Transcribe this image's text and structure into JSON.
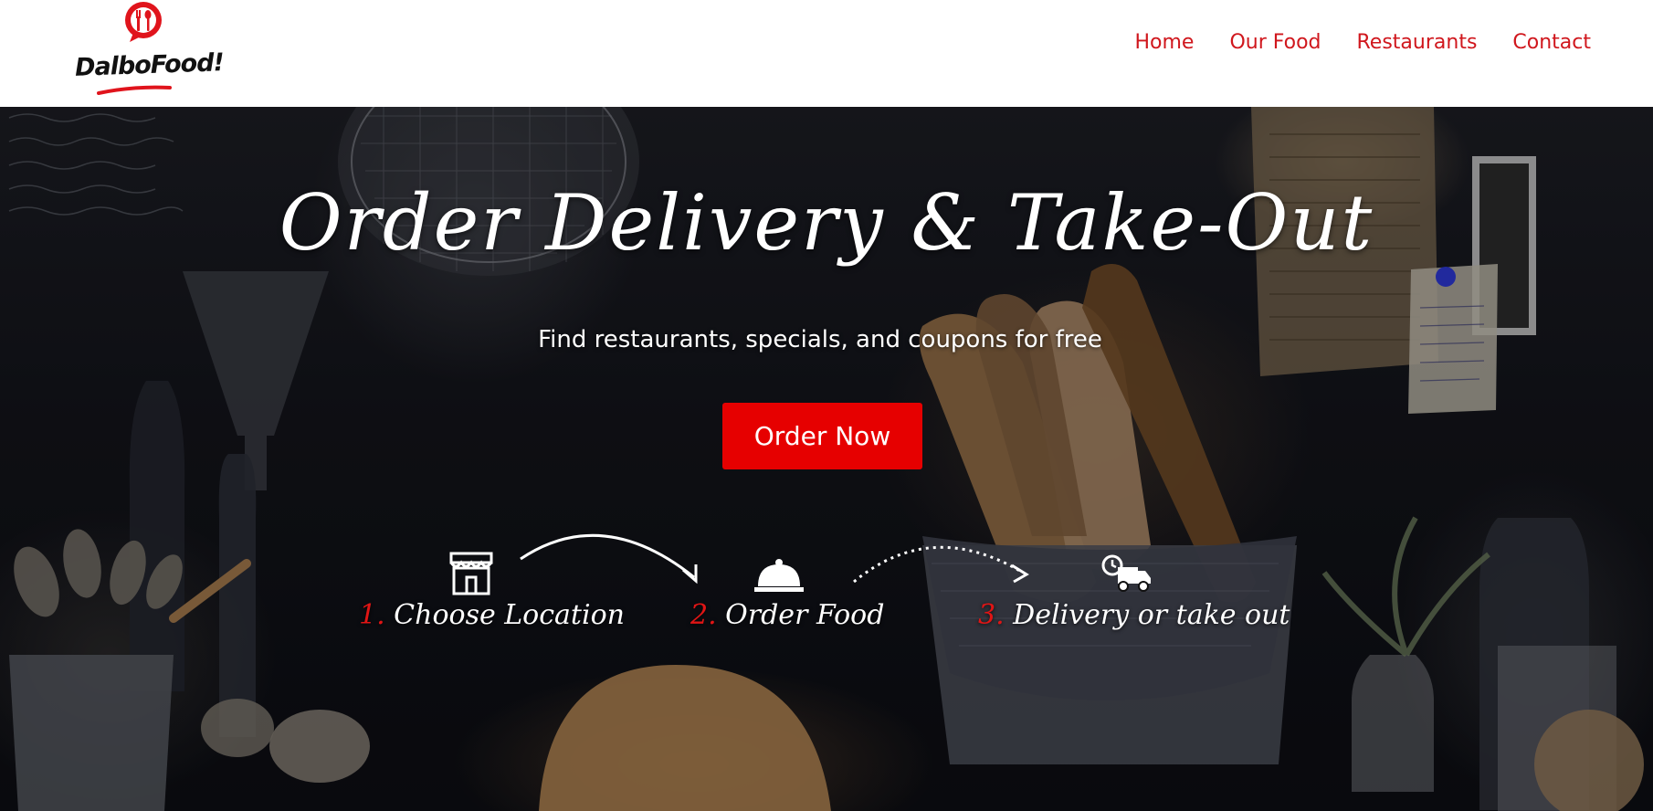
{
  "brand": {
    "logo_text": "DalboFood!"
  },
  "nav": {
    "items": [
      {
        "label": "Home"
      },
      {
        "label": "Our Food"
      },
      {
        "label": "Restaurants"
      },
      {
        "label": "Contact"
      }
    ]
  },
  "hero": {
    "title": "Order Delivery & Take-Out",
    "subtitle": "Find restaurants, specials, and coupons for free",
    "cta_label": "Order Now"
  },
  "steps": [
    {
      "number": "1.",
      "label": "Choose Location",
      "icon": "store-icon"
    },
    {
      "number": "2.",
      "label": "Order Food",
      "icon": "cloche-icon"
    },
    {
      "number": "3.",
      "label": "Delivery or take out",
      "icon": "delivery-truck-icon"
    }
  ],
  "colors": {
    "brand_red": "#e60000",
    "nav_red": "#d0171d",
    "header_bg": "#ffffff",
    "hero_text": "#ffffff"
  }
}
